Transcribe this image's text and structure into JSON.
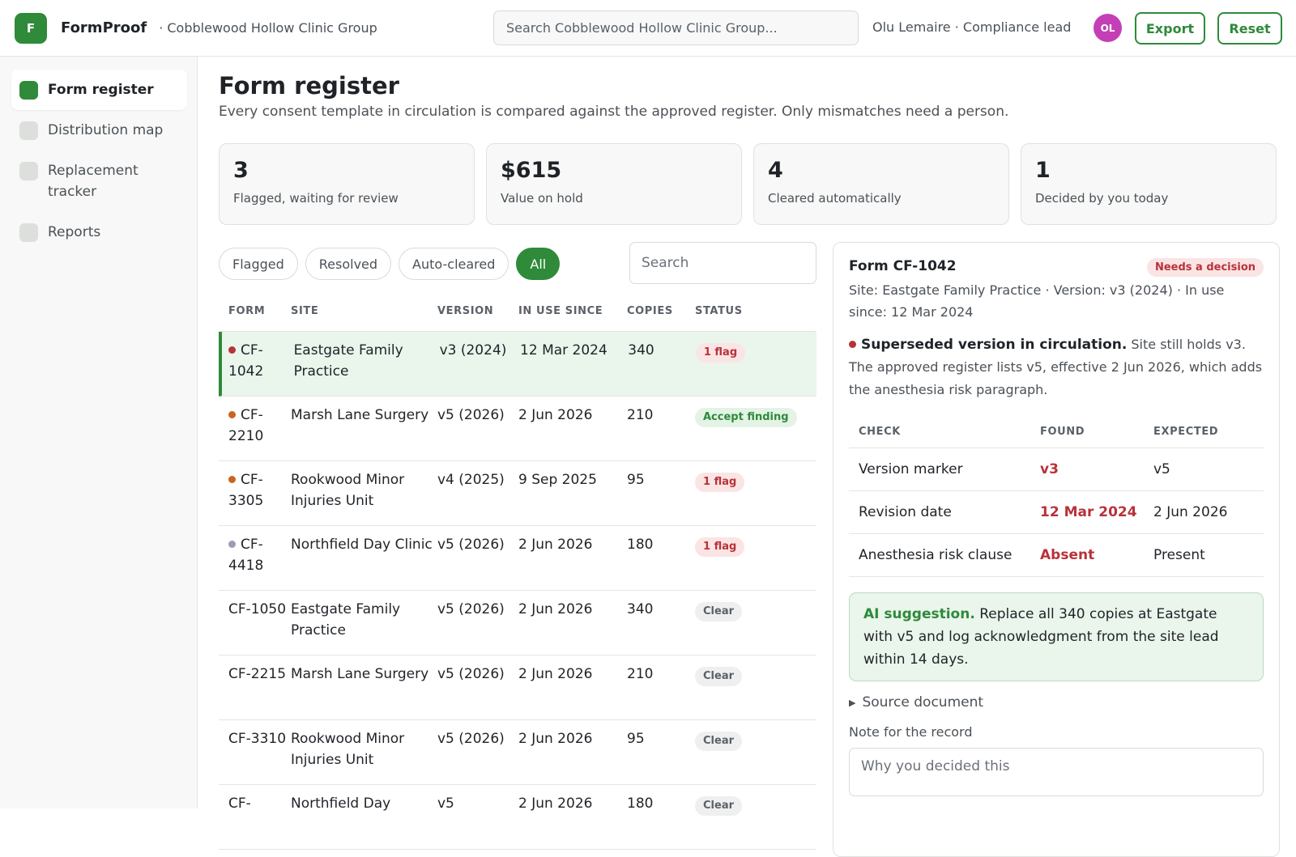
{
  "header": {
    "logo_letter": "F",
    "brand": "FormProof",
    "org": "· Cobblewood Hollow Clinic Group",
    "search_placeholder": "Search Cobblewood Hollow Clinic Group...",
    "user_label": "Olu Lemaire · Compliance lead",
    "avatar_initials": "OL",
    "export_label": "Export",
    "reset_label": "Reset"
  },
  "sidebar": {
    "items": [
      {
        "label": "Form register",
        "active": true
      },
      {
        "label": "Distribution map"
      },
      {
        "label": "Replacement tracker"
      },
      {
        "label": "Reports"
      }
    ]
  },
  "page": {
    "title": "Form register",
    "subtitle": "Every consent template in circulation is compared against the approved register. Only mismatches need a person."
  },
  "stats": [
    {
      "value": "3",
      "label": "Flagged, waiting for review"
    },
    {
      "value": "$615",
      "label": "Value on hold"
    },
    {
      "value": "4",
      "label": "Cleared automatically"
    },
    {
      "value": "1",
      "label": "Decided by you today"
    }
  ],
  "filters": {
    "chips": [
      "Flagged",
      "Resolved",
      "Auto-cleared",
      "All"
    ],
    "active": "All",
    "search_placeholder": "Search"
  },
  "table": {
    "columns": [
      "FORM",
      "SITE",
      "VERSION",
      "IN USE SINCE",
      "COPIES",
      "STATUS"
    ],
    "rows": [
      {
        "form": "CF-1042",
        "site": "Eastgate Family Practice",
        "version": "v3 (2024)",
        "since": "12 Mar 2024",
        "copies": "340",
        "status": "1 flag",
        "status_kind": "flag",
        "dot": "#b8323a"
      },
      {
        "form": "CF-2210",
        "site": "Marsh Lane Surgery",
        "version": "v5 (2026)",
        "since": "2 Jun 2026",
        "copies": "210",
        "status": "Accept finding",
        "status_kind": "accept",
        "dot": "#c8661f"
      },
      {
        "form": "CF-3305",
        "site": "Rookwood Minor Injuries Unit",
        "version": "v4 (2025)",
        "since": "9 Sep 2025",
        "copies": "95",
        "status": "1 flag",
        "status_kind": "flag",
        "dot": "#c8661f"
      },
      {
        "form": "CF-4418",
        "site": "Northfield Day Clinic",
        "version": "v5 (2026)",
        "since": "2 Jun 2026",
        "copies": "180",
        "status": "1 flag",
        "status_kind": "flag",
        "dot": "#9a9fb0"
      },
      {
        "form": "CF-1050",
        "site": "Eastgate Family Practice",
        "version": "v5 (2026)",
        "since": "2 Jun 2026",
        "copies": "340",
        "status": "Clear",
        "status_kind": "clear"
      },
      {
        "form": "CF-2215",
        "site": "Marsh Lane Surgery",
        "version": "v5 (2026)",
        "since": "2 Jun 2026",
        "copies": "210",
        "status": "Clear",
        "status_kind": "clear"
      },
      {
        "form": "CF-3310",
        "site": "Rookwood Minor Injuries Unit",
        "version": "v5 (2026)",
        "since": "2 Jun 2026",
        "copies": "95",
        "status": "Clear",
        "status_kind": "clear"
      },
      {
        "form": "CF-",
        "site": "Northfield Day",
        "version": "v5",
        "since": "2 Jun 2026",
        "copies": "180",
        "status": "Clear",
        "status_kind": "clear"
      }
    ]
  },
  "panel": {
    "title": "Form CF-1042",
    "badge": "Needs a decision",
    "meta": "Site: Eastgate Family Practice · Version: v3 (2024) · In use since: 12 Mar 2024",
    "finding_title": "Superseded version in circulation.",
    "finding_text": " Site still holds v3. The approved register lists v5, effective 2 Jun 2026, which adds the anesthesia risk paragraph.",
    "checks_head": [
      "CHECK",
      "FOUND",
      "EXPECTED"
    ],
    "checks": [
      {
        "check": "Version marker",
        "found": "v3",
        "expected": "v5"
      },
      {
        "check": "Revision date",
        "found": "12 Mar 2024",
        "expected": "2 Jun 2026"
      },
      {
        "check": "Anesthesia risk clause",
        "found": "Absent",
        "expected": "Present"
      }
    ],
    "ai_title": "AI suggestion.",
    "ai_text": " Replace all 340 copies at Eastgate with v5 and log acknowledgment from the site lead within 14 days.",
    "source_label": "Source document",
    "note_label": "Note for the record",
    "note_placeholder": "Why you decided this"
  }
}
